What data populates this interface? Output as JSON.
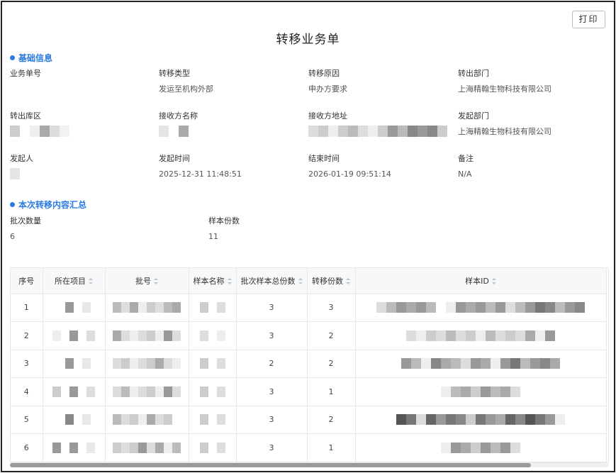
{
  "print_label": "打印",
  "title": "转移业务单",
  "basic": {
    "section_title": "基础信息",
    "business_no": {
      "label": "业务单号",
      "value": ""
    },
    "transfer_type": {
      "label": "转移类型",
      "value": "发运至机构外部"
    },
    "transfer_reason": {
      "label": "转移原因",
      "value": "申办方要求"
    },
    "out_dept": {
      "label": "转出部门",
      "value": "上海精翰生物科技有限公司"
    },
    "out_location": {
      "label": "转出库区"
    },
    "receiver_name": {
      "label": "接收方名称"
    },
    "receiver_address": {
      "label": "接收方地址"
    },
    "init_dept": {
      "label": "发起部门",
      "value": "上海精翰生物科技有限公司"
    },
    "initiator": {
      "label": "发起人"
    },
    "start_time": {
      "label": "发起时间",
      "value": "2025-12-31 11:48:51"
    },
    "end_time": {
      "label": "结束时间",
      "value": "2026-01-19 09:51:14"
    },
    "remark": {
      "label": "备注",
      "value": "N/A"
    }
  },
  "summary": {
    "section_title": "本次转移内容汇总",
    "batch_count": {
      "label": "批次数量",
      "value": "6"
    },
    "sample_count": {
      "label": "样本份数",
      "value": "11"
    }
  },
  "table": {
    "headers": [
      "序号",
      "所在项目",
      "批号",
      "样本名称",
      "批次样本总份数",
      "转移份数",
      "样本ID"
    ],
    "rows": [
      {
        "no": "1",
        "total": "3",
        "moved": "3"
      },
      {
        "no": "2",
        "total": "3",
        "moved": "2"
      },
      {
        "no": "3",
        "total": "2",
        "moved": "2"
      },
      {
        "no": "4",
        "total": "3",
        "moved": "1"
      },
      {
        "no": "5",
        "total": "3",
        "moved": "2"
      },
      {
        "no": "6",
        "total": "3",
        "moved": "1"
      }
    ]
  },
  "colors": {
    "accent": "#2a7ae2",
    "header_bg": "#f7f8fa"
  }
}
